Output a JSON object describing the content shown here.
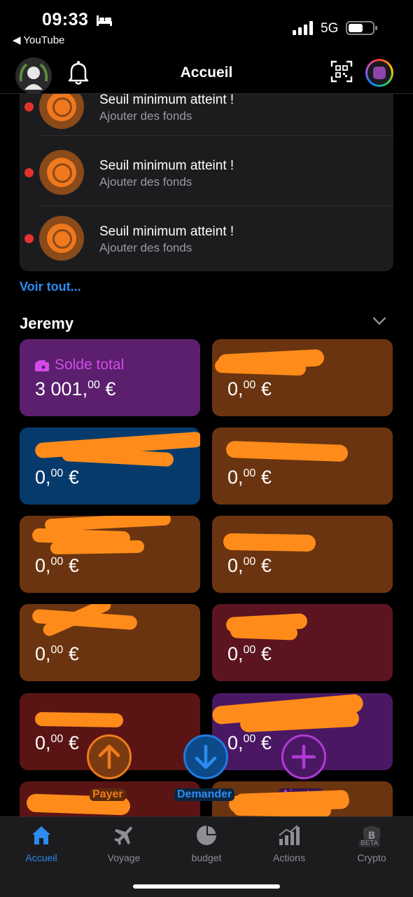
{
  "status_bar": {
    "time": "09:33",
    "back_app": "◀ YouTube",
    "network": "5G"
  },
  "header": {
    "title": "Accueil"
  },
  "notifications": {
    "items": [
      {
        "title": "Seuil minimum atteint !",
        "subtitle": "Ajouter des fonds"
      },
      {
        "title": "Seuil minimum atteint !",
        "subtitle": "Ajouter des fonds"
      },
      {
        "title": "Seuil minimum atteint !",
        "subtitle": "Ajouter des fonds"
      }
    ],
    "see_all": "Voir tout..."
  },
  "section": {
    "title": "Jeremy"
  },
  "accounts": [
    {
      "label": "Solde total",
      "value_int": "3 001,",
      "value_dec": "00",
      "currency": " €",
      "color": "#5b1f6e"
    },
    {
      "label": "",
      "value_int": "0,",
      "value_dec": "00",
      "currency": " €",
      "color": "#6b3410"
    },
    {
      "label": "",
      "value_int": "0,",
      "value_dec": "00",
      "currency": " €",
      "color": "#063a6d"
    },
    {
      "label": "",
      "value_int": "0,",
      "value_dec": "00",
      "currency": " €",
      "color": "#6b3410"
    },
    {
      "label": "",
      "value_int": "0,",
      "value_dec": "00",
      "currency": " €",
      "color": "#6b3410"
    },
    {
      "label": "",
      "value_int": "0,",
      "value_dec": "00",
      "currency": " €",
      "color": "#6b3410"
    },
    {
      "label": "",
      "value_int": "0,",
      "value_dec": "00",
      "currency": " €",
      "color": "#6b3410"
    },
    {
      "label": "",
      "value_int": "0,",
      "value_dec": "00",
      "currency": " €",
      "color": "#5c1520"
    },
    {
      "label": "",
      "value_int": "0,",
      "value_dec": "00",
      "currency": " €",
      "color": "#5a1414"
    },
    {
      "label": "",
      "value_int": "0,",
      "value_dec": "00",
      "currency": " €",
      "color": "#4a1863"
    },
    {
      "label": "",
      "value_int": "",
      "value_dec": "",
      "currency": "",
      "color": "#5a1414"
    },
    {
      "label": "",
      "value_int": "",
      "value_dec": "",
      "currency": "",
      "color": "#6b3410"
    }
  ],
  "actions": {
    "pay": {
      "label": "Payer",
      "color": "#f07a1a"
    },
    "request": {
      "label": "Demander",
      "color": "#1e7be0"
    },
    "add": {
      "label": "Ajouter",
      "color": "#b03ad6"
    }
  },
  "tabbar": {
    "tabs": [
      {
        "label": "Accueil",
        "icon": "home-icon"
      },
      {
        "label": "Voyage",
        "icon": "airplane-icon"
      },
      {
        "label": "budget",
        "icon": "pie-chart-icon"
      },
      {
        "label": "Actions",
        "icon": "bar-chart-icon"
      },
      {
        "label": "Crypto",
        "icon": "bitcoin-shield-icon",
        "badge": "BETA"
      }
    ]
  },
  "colors": {
    "accent": "#2d8cf0",
    "pay": "#f07a1a",
    "request": "#1e7be0",
    "add": "#b03ad6"
  }
}
